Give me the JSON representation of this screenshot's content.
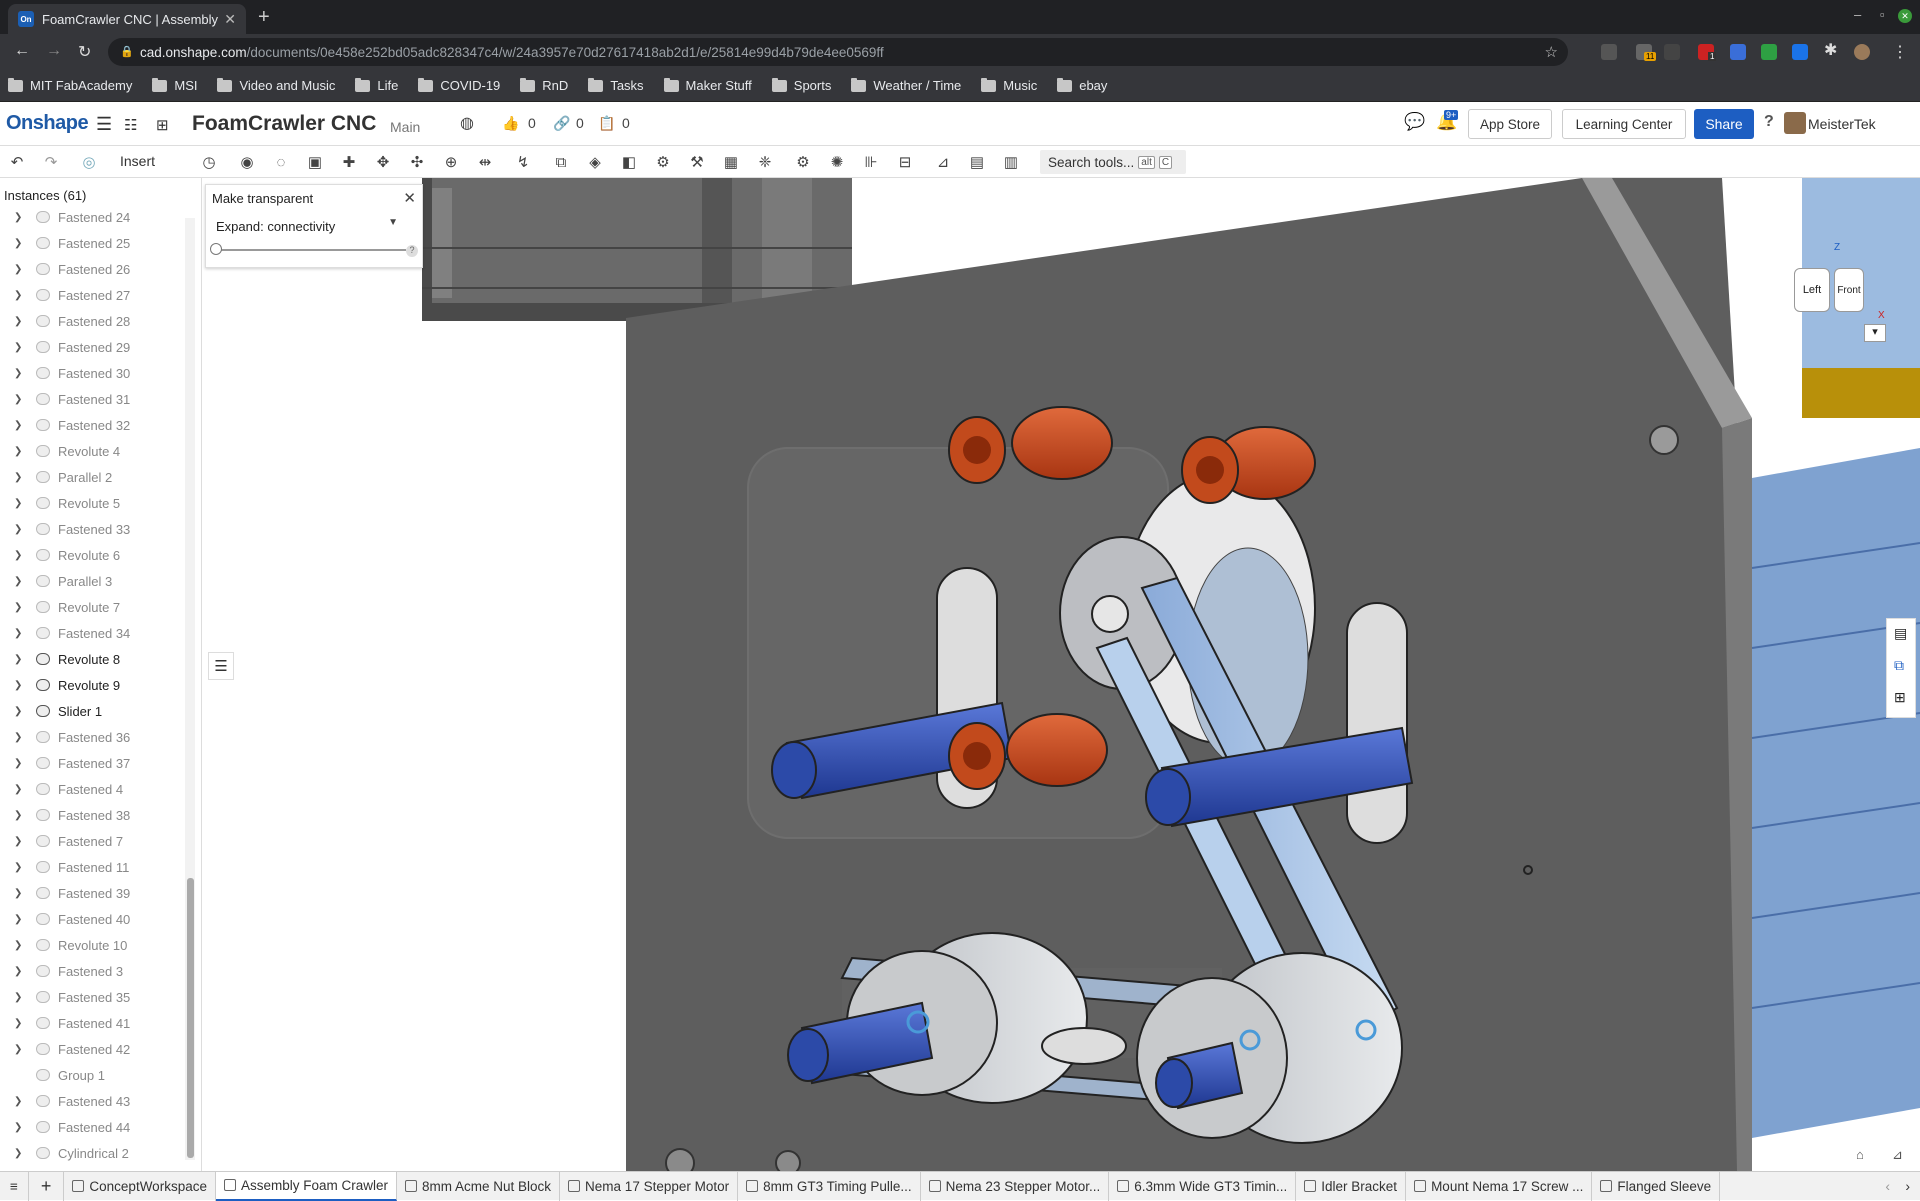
{
  "browser": {
    "tab_title": "FoamCrawler CNC | Assembly",
    "favicon": "On",
    "url_host": "cad.onshape.com",
    "url_path": "/documents/0e458e252bd05adc828347c4/w/24a3957e70d27617418ab2d1/e/25814e99d4b79de4ee0569ff",
    "bookmarks": [
      "MIT FabAcademy",
      "MSI",
      "Video and Music",
      "Life",
      "COVID-19",
      "RnD",
      "Tasks",
      "Maker Stuff",
      "Sports",
      "Weather / Time",
      "Music",
      "ebay"
    ],
    "ext_badges": [
      "11",
      "1"
    ]
  },
  "header": {
    "logo": "Onshape",
    "doc_title": "FoamCrawler CNC",
    "branch": "Main",
    "likes": "0",
    "links": "0",
    "copies": "0",
    "notif_badge": "9+",
    "app_store": "App Store",
    "learning_center": "Learning Center",
    "share": "Share",
    "help": "?",
    "user": "MeisterTek"
  },
  "toolbar": {
    "insert": "Insert",
    "search": "Search tools...",
    "kbd1": "alt",
    "kbd2": "C"
  },
  "instances": {
    "title": "Instances (61)",
    "items": [
      {
        "label": "Fastened 24",
        "dark": false
      },
      {
        "label": "Fastened 25",
        "dark": false
      },
      {
        "label": "Fastened 26",
        "dark": false
      },
      {
        "label": "Fastened 27",
        "dark": false
      },
      {
        "label": "Fastened 28",
        "dark": false
      },
      {
        "label": "Fastened 29",
        "dark": false
      },
      {
        "label": "Fastened 30",
        "dark": false
      },
      {
        "label": "Fastened 31",
        "dark": false
      },
      {
        "label": "Fastened 32",
        "dark": false
      },
      {
        "label": "Revolute 4",
        "dark": false
      },
      {
        "label": "Parallel 2",
        "dark": false
      },
      {
        "label": "Revolute 5",
        "dark": false
      },
      {
        "label": "Fastened 33",
        "dark": false
      },
      {
        "label": "Revolute 6",
        "dark": false
      },
      {
        "label": "Parallel 3",
        "dark": false
      },
      {
        "label": "Revolute 7",
        "dark": false
      },
      {
        "label": "Fastened 34",
        "dark": false
      },
      {
        "label": "Revolute 8",
        "dark": true
      },
      {
        "label": "Revolute 9",
        "dark": true
      },
      {
        "label": "Slider 1",
        "dark": true
      },
      {
        "label": "Fastened 36",
        "dark": false
      },
      {
        "label": "Fastened 37",
        "dark": false
      },
      {
        "label": "Fastened 4",
        "dark": false
      },
      {
        "label": "Fastened 38",
        "dark": false
      },
      {
        "label": "Fastened 7",
        "dark": false
      },
      {
        "label": "Fastened 11",
        "dark": false
      },
      {
        "label": "Fastened 39",
        "dark": false
      },
      {
        "label": "Fastened 40",
        "dark": false
      },
      {
        "label": "Revolute 10",
        "dark": false
      },
      {
        "label": "Fastened 3",
        "dark": false
      },
      {
        "label": "Fastened 35",
        "dark": false
      },
      {
        "label": "Fastened 41",
        "dark": false
      },
      {
        "label": "Fastened 42",
        "dark": false
      },
      {
        "label": "Group 1",
        "dark": false
      },
      {
        "label": "Fastened 43",
        "dark": false
      },
      {
        "label": "Fastened 44",
        "dark": false
      },
      {
        "label": "Cylindrical 2",
        "dark": false
      }
    ]
  },
  "transparent_panel": {
    "title": "Make transparent",
    "dropdown": "Expand: connectivity"
  },
  "viewcube": {
    "left": "Left",
    "front": "Front",
    "z": "Z",
    "x": "X"
  },
  "bottom_tabs": [
    "ConceptWorkspace",
    "Assembly Foam Crawler",
    "8mm Acme Nut Block",
    "Nema 17 Stepper Motor",
    "8mm GT3 Timing Pulle...",
    "Nema 23 Stepper Motor...",
    "6.3mm Wide GT3 Timin...",
    "Idler Bracket",
    "Mount Nema 17 Screw ...",
    "Flanged Sleeve"
  ],
  "colors": {
    "accent": "#1d5ec2",
    "plate": "#5e5e5e",
    "orange": "#c24a1c",
    "blue": "#2c4aa8"
  }
}
